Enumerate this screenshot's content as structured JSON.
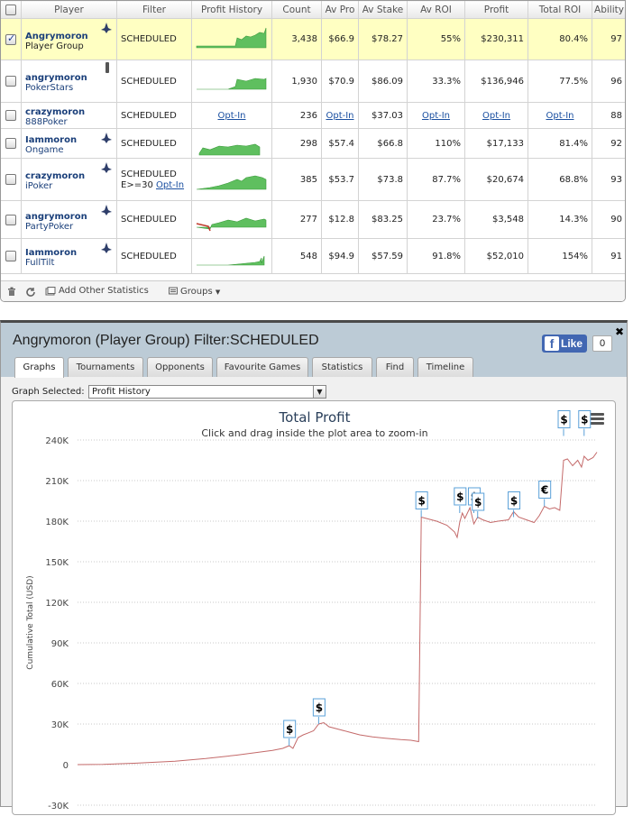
{
  "stats_table": {
    "columns": [
      "Player",
      "Filter",
      "Profit History",
      "Count",
      "Av Pro",
      "Av Stake",
      "Av ROI",
      "Profit",
      "Total ROI",
      "Ability"
    ],
    "rows": [
      {
        "name": "Angrymoron",
        "site": "Player Group",
        "filter": "SCHEDULED",
        "history": "spark",
        "count": "3,438",
        "av_profit": "$66.9",
        "av_stake": "$78.27",
        "av_roi": "55%",
        "profit": "$230,311",
        "total_roi": "80.4%",
        "ability": "97",
        "checked": true,
        "icon": "shark"
      },
      {
        "name": "angrymoron",
        "site": "PokerStars",
        "filter": "SCHEDULED",
        "history": "spark",
        "count": "1,930",
        "av_profit": "$70.9",
        "av_stake": "$86.09",
        "av_roi": "33.3%",
        "profit": "$136,946",
        "total_roi": "77.5%",
        "ability": "96",
        "checked": false,
        "icon": "phone"
      },
      {
        "name": "crazymoron",
        "site": "888Poker",
        "filter": "SCHEDULED",
        "history": "Opt-In",
        "count": "236",
        "av_profit": "Opt-In",
        "av_stake": "$37.03",
        "av_roi": "Opt-In",
        "profit": "Opt-In",
        "total_roi": "Opt-In",
        "ability": "88",
        "checked": false,
        "icon": ""
      },
      {
        "name": "Iammoron",
        "site": "Ongame",
        "filter": "SCHEDULED",
        "history": "spark",
        "count": "298",
        "av_profit": "$57.4",
        "av_stake": "$66.8",
        "av_roi": "110%",
        "profit": "$17,133",
        "total_roi": "81.4%",
        "ability": "92",
        "checked": false,
        "icon": "shark"
      },
      {
        "name": "crazymoron",
        "site": "iPoker",
        "filter": "SCHEDULED",
        "filter2": "E>=30",
        "filter_link": "Opt-In",
        "history": "spark",
        "count": "385",
        "av_profit": "$53.7",
        "av_stake": "$73.8",
        "av_roi": "87.7%",
        "profit": "$20,674",
        "total_roi": "68.8%",
        "ability": "93",
        "checked": false,
        "icon": "shark"
      },
      {
        "name": "angrymoron",
        "site": "PartyPoker",
        "filter": "SCHEDULED",
        "history": "spark",
        "count": "277",
        "av_profit": "$12.8",
        "av_stake": "$83.25",
        "av_roi": "23.7%",
        "profit": "$3,548",
        "total_roi": "14.3%",
        "ability": "90",
        "checked": false,
        "icon": "shark"
      },
      {
        "name": "Iammoron",
        "site": "FullTilt",
        "filter": "SCHEDULED",
        "history": "spark",
        "count": "548",
        "av_profit": "$94.9",
        "av_stake": "$57.59",
        "av_roi": "91.8%",
        "profit": "$52,010",
        "total_roi": "154%",
        "ability": "91",
        "checked": false,
        "icon": "shark"
      }
    ]
  },
  "toolbar": {
    "add_stats": "Add Other Statistics",
    "groups": "Groups"
  },
  "window": {
    "title": "Angrymoron (Player Group) Filter:SCHEDULED",
    "like_label": "Like",
    "like_count": "0",
    "tabs": [
      "Graphs",
      "Tournaments",
      "Opponents",
      "Favourite Games",
      "Statistics",
      "Find",
      "Timeline"
    ],
    "graph_selected_label": "Graph Selected:",
    "graph_selected_value": "Profit History"
  },
  "chart_data": {
    "type": "line",
    "title": "Total Profit",
    "subtitle": "Click and drag inside the plot area to zoom-in",
    "ylabel": "Cumulative Total (USD)",
    "yticks": [
      "240K",
      "210K",
      "180K",
      "150K",
      "120K",
      "90K",
      "60K",
      "30K",
      "0",
      "-30K"
    ],
    "ytick_values": [
      240000,
      210000,
      180000,
      150000,
      120000,
      90000,
      60000,
      30000,
      0,
      -30000
    ],
    "ylim": [
      -30000,
      240000
    ],
    "line_color": "#c46a6a",
    "series": [
      {
        "values": [
          [
            0,
            0
          ],
          [
            100,
            200
          ],
          [
            220,
            1000
          ],
          [
            380,
            2500
          ],
          [
            500,
            4500
          ],
          [
            620,
            7000
          ],
          [
            700,
            9000
          ],
          [
            760,
            10500
          ],
          [
            800,
            12000
          ],
          [
            825,
            14000
          ],
          [
            840,
            12000
          ],
          [
            860,
            20000
          ],
          [
            880,
            22000
          ],
          [
            900,
            23500
          ],
          [
            920,
            25000
          ],
          [
            940,
            30000
          ],
          [
            960,
            31000
          ],
          [
            980,
            28000
          ],
          [
            1020,
            26000
          ],
          [
            1060,
            24000
          ],
          [
            1100,
            22000
          ],
          [
            1150,
            20500
          ],
          [
            1200,
            19500
          ],
          [
            1260,
            18500
          ],
          [
            1300,
            18000
          ],
          [
            1330,
            17000
          ],
          [
            1340,
            183000
          ],
          [
            1360,
            182000
          ],
          [
            1400,
            180000
          ],
          [
            1440,
            177000
          ],
          [
            1470,
            172000
          ],
          [
            1480,
            168000
          ],
          [
            1490,
            179000
          ],
          [
            1500,
            186000
          ],
          [
            1510,
            182000
          ],
          [
            1530,
            190000
          ],
          [
            1545,
            178000
          ],
          [
            1560,
            183000
          ],
          [
            1580,
            181000
          ],
          [
            1610,
            179000
          ],
          [
            1640,
            180000
          ],
          [
            1680,
            181000
          ],
          [
            1700,
            187000
          ],
          [
            1720,
            183000
          ],
          [
            1750,
            181000
          ],
          [
            1780,
            179000
          ],
          [
            1800,
            184000
          ],
          [
            1820,
            191000
          ],
          [
            1840,
            189000
          ],
          [
            1860,
            190000
          ],
          [
            1880,
            188000
          ],
          [
            1895,
            225000
          ],
          [
            1910,
            226000
          ],
          [
            1930,
            221000
          ],
          [
            1950,
            225000
          ],
          [
            1965,
            220000
          ],
          [
            1975,
            228000
          ],
          [
            1990,
            225000
          ],
          [
            2010,
            227000
          ],
          [
            2025,
            231000
          ]
        ]
      }
    ],
    "markers": [
      {
        "x": 825,
        "y": 14000,
        "symbol": "$"
      },
      {
        "x": 940,
        "y": 30000,
        "symbol": "$"
      },
      {
        "x": 1340,
        "y": 183000,
        "symbol": "$"
      },
      {
        "x": 1490,
        "y": 186000,
        "symbol": "$"
      },
      {
        "x": 1545,
        "y": 186000,
        "symbol": "$"
      },
      {
        "x": 1560,
        "y": 182000,
        "symbol": "$"
      },
      {
        "x": 1700,
        "y": 183000,
        "symbol": "$"
      },
      {
        "x": 1820,
        "y": 191000,
        "symbol": "€"
      },
      {
        "x": 1895,
        "y": 243000,
        "symbol": "$"
      },
      {
        "x": 1975,
        "y": 243000,
        "symbol": "$"
      }
    ],
    "grid": true,
    "legend": "none"
  },
  "colors": {
    "header_bar": "#bccbd6",
    "selected_row": "#ffffc2",
    "spark_green": "#5fbf5f",
    "link": "#1a4fa0",
    "title_blue": "#2a3f5a"
  }
}
